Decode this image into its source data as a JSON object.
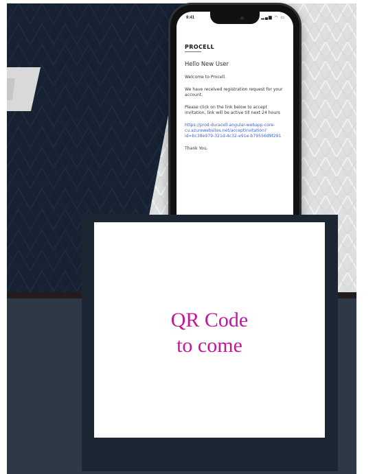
{
  "screen": {
    "background_color": "#ffffff"
  },
  "phone_email": {
    "status_time": "9:41",
    "status_icons": "▂▄▆ ◠ ▭",
    "logo": "PROCELL",
    "greeting": "Hello New User",
    "welcome": "Welcome to Procell.",
    "registration": "We have received registration request for your account.",
    "instruction": "Please click on the link below to accept invitation, link will be active till next 24 hours",
    "link": "https://prod-duracell-angular-webapp-core-cu.azurewebsites.net/acceptinvitation?id=bc38e979-321d-4c32-e91e-b79556d9f291",
    "thanks": "Thank You,"
  },
  "qr_placeholder": {
    "line1": "QR Code",
    "line2": "to come",
    "text_color": "#c4169c"
  },
  "colors": {
    "navy": "#172230",
    "slate": "#2d3946",
    "dark_band": "#221c1e",
    "link_blue": "#3d63d8"
  }
}
